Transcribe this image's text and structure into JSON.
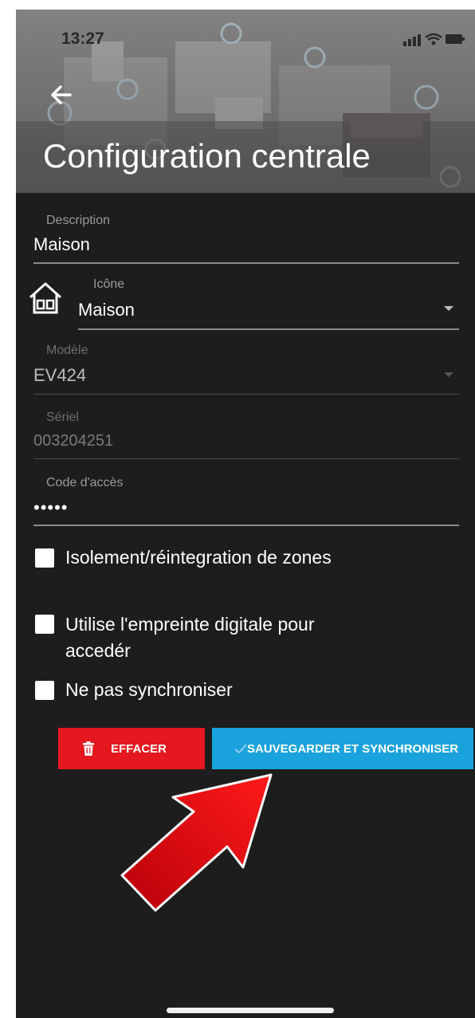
{
  "status_bar": {
    "time": "13:27"
  },
  "header": {
    "title": "Configuration centrale"
  },
  "form": {
    "description": {
      "label": "Description",
      "value": "Maison"
    },
    "icon": {
      "label": "Icône",
      "value": "Maison"
    },
    "model": {
      "label": "Modèle",
      "value": "EV424"
    },
    "serial": {
      "label": "Sériel",
      "value": "003204251"
    },
    "access_code": {
      "label": "Code d'accès",
      "value": "•••••"
    }
  },
  "options": [
    {
      "label": "Isolement/réintegration de zones"
    },
    {
      "label_line1": "Utilise l'empreinte digitale pour",
      "label_line2": "accedér"
    },
    {
      "label": "Ne pas synchroniser"
    }
  ],
  "actions": {
    "delete_label": "EFFACER",
    "save_label": "SAUVEGARDER ET SYNCHRONISER"
  },
  "colors": {
    "background": "#1d1d1d",
    "delete": "#e5171f",
    "save": "#1aa2dc",
    "annotation_arrow": "#e30613"
  }
}
